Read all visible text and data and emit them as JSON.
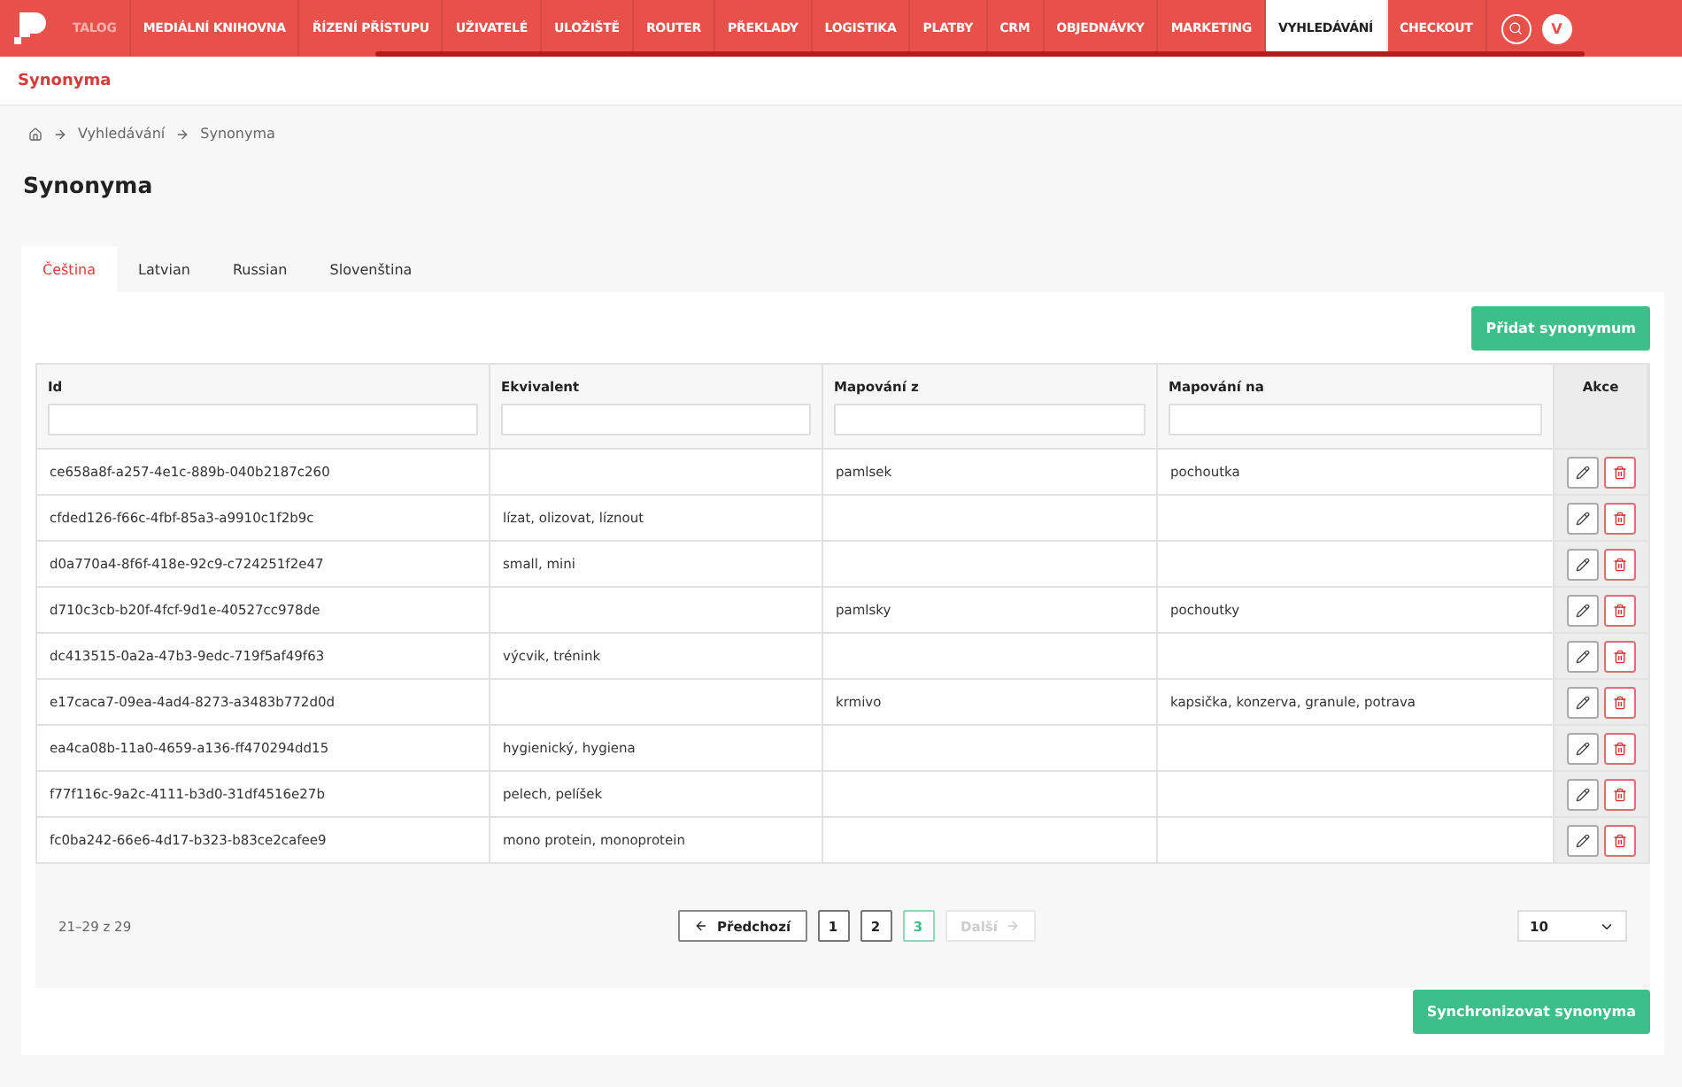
{
  "nav": {
    "items": [
      {
        "label": "TALOG",
        "selected": false,
        "faded": true
      },
      {
        "label": "MEDIÁLNÍ KNIHOVNA",
        "selected": false
      },
      {
        "label": "ŘÍZENÍ PŘÍSTUPU",
        "selected": false
      },
      {
        "label": "UŽIVATELÉ",
        "selected": false
      },
      {
        "label": "ULOŽIŠTĚ",
        "selected": false
      },
      {
        "label": "ROUTER",
        "selected": false
      },
      {
        "label": "PŘEKLADY",
        "selected": false
      },
      {
        "label": "LOGISTIKA",
        "selected": false
      },
      {
        "label": "PLATBY",
        "selected": false
      },
      {
        "label": "CRM",
        "selected": false
      },
      {
        "label": "OBJEDNÁVKY",
        "selected": false
      },
      {
        "label": "MARKETING",
        "selected": false
      },
      {
        "label": "VYHLEDÁVÁNÍ",
        "selected": true
      },
      {
        "label": "CHECKOUT",
        "selected": false
      }
    ],
    "avatar": "V"
  },
  "subheader": "Synonyma",
  "breadcrumb": [
    "Vyhledávání",
    "Synonyma"
  ],
  "title": "Synonyma",
  "tabs": [
    {
      "label": "Čeština",
      "selected": true
    },
    {
      "label": "Latvian",
      "selected": false
    },
    {
      "label": "Russian",
      "selected": false
    },
    {
      "label": "Slovenština",
      "selected": false
    }
  ],
  "add_button": "Přidat synonymum",
  "table": {
    "columns": [
      "Id",
      "Ekvivalent",
      "Mapování z",
      "Mapování na",
      "Akce"
    ],
    "rows": [
      [
        "ce658a8f-a257-4e1c-889b-040b2187c260",
        "",
        "pamlsek",
        "pochoutka"
      ],
      [
        "cfded126-f66c-4fbf-85a3-a9910c1f2b9c",
        "lízat, olizovat, líznout",
        "",
        ""
      ],
      [
        "d0a770a4-8f6f-418e-92c9-c724251f2e47",
        "small, mini",
        "",
        ""
      ],
      [
        "d710c3cb-b20f-4fcf-9d1e-40527cc978de",
        "",
        "pamlsky",
        "pochoutky"
      ],
      [
        "dc413515-0a2a-47b3-9edc-719f5af49f63",
        "výcvik, trénink",
        "",
        ""
      ],
      [
        "e17caca7-09ea-4ad4-8273-a3483b772d0d",
        "",
        "krmivo",
        "kapsička, konzerva, granule, potrava"
      ],
      [
        "ea4ca08b-11a0-4659-a136-ff470294dd15",
        "hygienický, hygiena",
        "",
        ""
      ],
      [
        "f77f116c-9a2c-4111-b3d0-31df4516e27b",
        "pelech, pelíšek",
        "",
        ""
      ],
      [
        "fc0ba242-66e6-4d17-b323-b83ce2cafee9",
        "mono protein, monoprotein",
        "",
        ""
      ]
    ]
  },
  "pagination": {
    "summary": "21–29 z 29",
    "prev": {
      "label": "Předchozí",
      "disabled": false
    },
    "pages": [
      {
        "label": "1",
        "selected": false
      },
      {
        "label": "2",
        "selected": false
      },
      {
        "label": "3",
        "selected": true
      }
    ],
    "next": {
      "label": "Další",
      "disabled": true
    },
    "page_size": "10"
  },
  "sync_button": "Synchronizovat synonyma"
}
